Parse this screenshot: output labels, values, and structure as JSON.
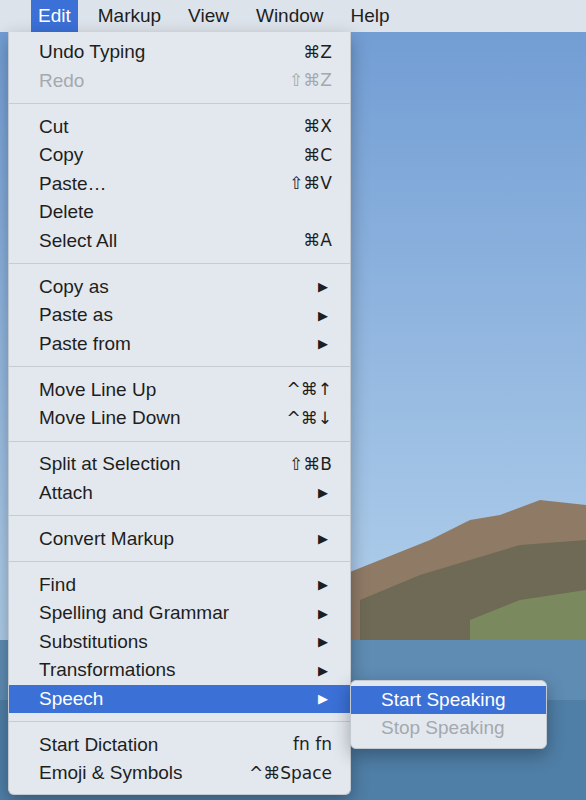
{
  "menu_bar": [
    {
      "label": "Edit",
      "selected": true
    },
    {
      "label": "Markup",
      "selected": false
    },
    {
      "label": "View",
      "selected": false
    },
    {
      "label": "Window",
      "selected": false
    },
    {
      "label": "Help",
      "selected": false
    }
  ],
  "menu": {
    "sections": [
      {
        "items": [
          {
            "label": "Undo Typing",
            "shortcut": "⌘Z",
            "disabled": false,
            "selected": false
          },
          {
            "label": "Redo",
            "shortcut": "⇧⌘Z",
            "disabled": true,
            "selected": false
          }
        ]
      },
      {
        "items": [
          {
            "label": "Cut",
            "shortcut": "⌘X",
            "disabled": false,
            "selected": false
          },
          {
            "label": "Copy",
            "shortcut": "⌘C",
            "disabled": false,
            "selected": false
          },
          {
            "label": "Paste…",
            "shortcut": "⇧⌘V",
            "disabled": false,
            "selected": false
          },
          {
            "label": "Delete",
            "disabled": false,
            "selected": false
          },
          {
            "label": "Select All",
            "shortcut": "⌘A",
            "disabled": false,
            "selected": false
          }
        ]
      },
      {
        "items": [
          {
            "label": "Copy as",
            "arrow": "▶",
            "disabled": false,
            "selected": false
          },
          {
            "label": "Paste as",
            "arrow": "▶",
            "disabled": false,
            "selected": false
          },
          {
            "label": "Paste from",
            "arrow": "▶",
            "disabled": false,
            "selected": false
          }
        ]
      },
      {
        "items": [
          {
            "label": "Move Line Up",
            "shortcut": "^⌘↑",
            "disabled": false,
            "selected": false
          },
          {
            "label": "Move Line Down",
            "shortcut": "^⌘↓",
            "disabled": false,
            "selected": false
          }
        ]
      },
      {
        "items": [
          {
            "label": "Split at Selection",
            "shortcut": "⇧⌘B",
            "disabled": false,
            "selected": false
          },
          {
            "label": "Attach",
            "arrow": "▶",
            "disabled": false,
            "selected": false
          }
        ]
      },
      {
        "items": [
          {
            "label": "Convert Markup",
            "arrow": "▶",
            "disabled": false,
            "selected": false
          }
        ]
      },
      {
        "items": [
          {
            "label": "Find",
            "arrow": "▶",
            "disabled": false,
            "selected": false
          },
          {
            "label": "Spelling and Grammar",
            "arrow": "▶",
            "disabled": false,
            "selected": false
          },
          {
            "label": "Substitutions",
            "arrow": "▶",
            "disabled": false,
            "selected": false
          },
          {
            "label": "Transformations",
            "arrow": "▶",
            "disabled": false,
            "selected": false
          },
          {
            "label": "Speech",
            "arrow": "▶",
            "disabled": false,
            "selected": true
          }
        ]
      },
      {
        "items": [
          {
            "label": "Start Dictation",
            "shortcut": "fn fn",
            "disabled": false,
            "selected": false
          },
          {
            "label": "Emoji & Symbols",
            "shortcut": "^⌘Space",
            "disabled": false,
            "selected": false
          }
        ]
      }
    ]
  },
  "submenu": {
    "items": [
      {
        "label": "Start Speaking",
        "disabled": false,
        "selected": true
      },
      {
        "label": "Stop Speaking",
        "disabled": true,
        "selected": false
      }
    ]
  }
}
